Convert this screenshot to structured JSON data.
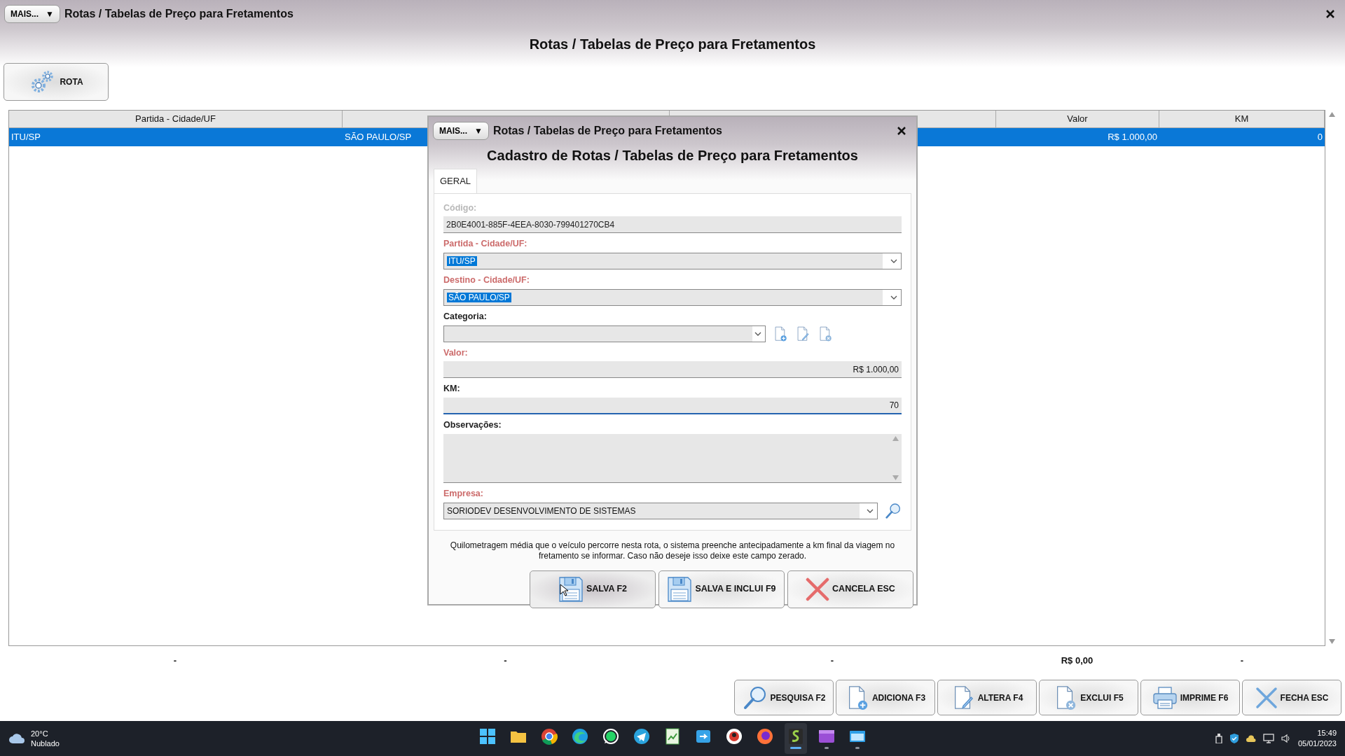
{
  "window": {
    "menu_button": "MAIS...",
    "menu_caret": "▼",
    "title": "Rotas / Tabelas de Preço para Fretamentos"
  },
  "heading": "Rotas / Tabelas de Preço para Fretamentos",
  "toolbar": [
    {
      "label": "ROTA",
      "kind": "gear"
    }
  ],
  "table": {
    "columns": [
      "Partida - Cidade/UF",
      null,
      null,
      "Valor",
      "KM"
    ],
    "rows": [
      {
        "selected": true,
        "cells": [
          "ITU/SP",
          "SÃO PAULO/SP",
          null,
          "R$ 1.000,00",
          "0"
        ]
      }
    ],
    "totals": [
      "-",
      "-",
      "-",
      "R$ 0,00",
      "-"
    ]
  },
  "actions": [
    {
      "label": "PESQUISA F2",
      "kind": "search"
    },
    {
      "label": "ADICIONA F3",
      "kind": "doc-add"
    },
    {
      "label": "ALTERA F4",
      "kind": "doc-edit"
    },
    {
      "label": "EXCLUI F5",
      "kind": "doc-remove"
    },
    {
      "label": "IMPRIME F6",
      "kind": "printer"
    },
    {
      "label": "FECHA ESC",
      "kind": "close-x"
    }
  ],
  "dialog": {
    "menu_button": "MAIS...",
    "menu_caret": "▼",
    "title": "Rotas / Tabelas de Preço para Fretamentos",
    "heading": "Cadastro de Rotas / Tabelas de Preço para Fretamentos",
    "tabs": [
      {
        "label": "GERAL",
        "selected": true
      }
    ],
    "fields": [
      {
        "label": "Código:",
        "kind": "text",
        "value": "2B0E4001-885F-4EEA-8030-799401270CB4",
        "required": false,
        "disabled": true,
        "focused": false,
        "highlighted": false
      },
      {
        "label": "Partida - Cidade/UF:",
        "kind": "select",
        "value": "ITU/SP",
        "required": true,
        "disabled": false,
        "focused": false,
        "highlighted": true
      },
      {
        "label": "Destino - Cidade/UF:",
        "kind": "select",
        "value": "SÃO PAULO/SP",
        "required": true,
        "disabled": false,
        "focused": false,
        "highlighted": true
      },
      {
        "label": "Categoria:",
        "kind": "select-actions",
        "required": false,
        "disabled": false,
        "focused": false,
        "highlighted": false
      },
      {
        "label": "Valor:",
        "kind": "number",
        "value": "R$ 1.000,00",
        "required": true,
        "disabled": false,
        "focused": false,
        "highlighted": false
      },
      {
        "label": "KM:",
        "kind": "number",
        "value": "70",
        "required": false,
        "disabled": false,
        "focused": true,
        "highlighted": false
      },
      {
        "label": "Observações:",
        "kind": "textarea",
        "required": false,
        "disabled": false,
        "focused": false,
        "highlighted": false
      },
      {
        "label": "Empresa:",
        "kind": "select-search",
        "value": "SORIODEV DESENVOLVIMENTO DE SISTEMAS",
        "required": true,
        "disabled": false,
        "focused": false,
        "highlighted": false
      }
    ],
    "hint": "Quilometragem média que o veículo percorre nesta rota, o sistema preenche antecipadamente a km final da viagem no fretamento se informar. Caso não deseje isso deixe este campo zerado.",
    "buttons": [
      {
        "label": "SALVA F2",
        "kind": "floppy",
        "hovered": true
      },
      {
        "label": "SALVA E INCLUI F9",
        "kind": "floppy",
        "hovered": false
      },
      {
        "label": "CANCELA ESC",
        "kind": "cross",
        "hovered": false
      }
    ]
  },
  "taskbar": {
    "weather": {
      "temperature": "20°C",
      "condition": "Nublado"
    },
    "apps": [
      {
        "kind": "start",
        "active": false,
        "running": false
      },
      {
        "kind": "folder",
        "active": false,
        "running": false
      },
      {
        "kind": "chrome",
        "active": false,
        "running": false
      },
      {
        "kind": "edge",
        "active": false,
        "running": false
      },
      {
        "kind": "whatsapp",
        "active": false,
        "running": false
      },
      {
        "kind": "telegram",
        "active": false,
        "running": false
      },
      {
        "kind": "sheet",
        "active": false,
        "running": false
      },
      {
        "kind": "remote",
        "active": false,
        "running": false
      },
      {
        "kind": "badge",
        "active": false,
        "running": false
      },
      {
        "kind": "firefox",
        "active": false,
        "running": false
      },
      {
        "kind": "sg",
        "active": true,
        "running": true
      },
      {
        "kind": "video",
        "active": false,
        "running": true
      },
      {
        "kind": "window",
        "active": false,
        "running": true
      }
    ],
    "time": "15:49",
    "date": "05/01/2023"
  }
}
